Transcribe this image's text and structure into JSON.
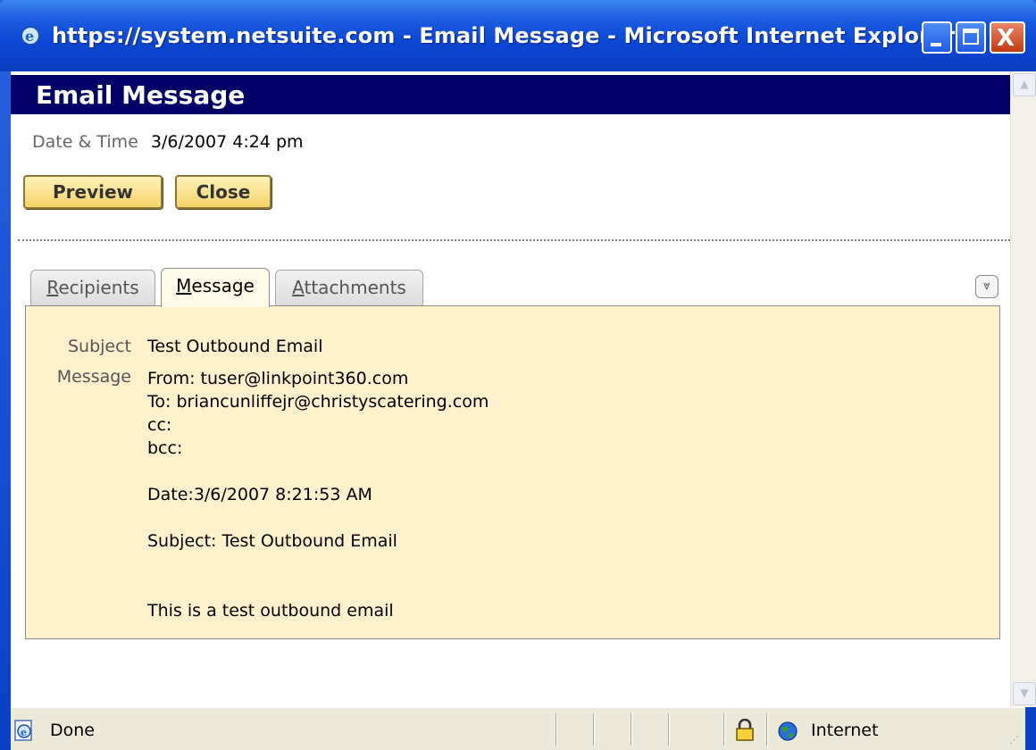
{
  "window": {
    "title": "https://system.netsuite.com - Email Message - Microsoft Internet Explorer",
    "controls": {
      "minimize": "minimize",
      "maximize": "maximize",
      "close": "X"
    }
  },
  "page": {
    "header": "Email Message",
    "date_time_label": "Date & Time",
    "date_time_value": "3/6/2007 4:24 pm",
    "buttons": {
      "preview": "Preview",
      "close": "Close"
    }
  },
  "tabs": [
    {
      "first": "R",
      "rest": "ecipients",
      "active": false
    },
    {
      "first": "M",
      "rest": "essage",
      "active": true
    },
    {
      "first": "A",
      "rest": "ttachments",
      "active": false
    }
  ],
  "message_panel": {
    "subject_label": "Subject",
    "subject_value": "Test Outbound Email",
    "message_label": "Message",
    "message_lines": [
      "From: tuser@linkpoint360.com",
      "To: briancunliffejr@christyscatering.com",
      "cc:",
      "bcc:",
      "",
      "Date:3/6/2007 8:21:53 AM",
      "",
      "Subject: Test Outbound Email",
      "",
      "",
      "This is a test outbound email"
    ]
  },
  "statusbar": {
    "status": "Done",
    "zone": "Internet"
  },
  "icons": {
    "ie": "ie-icon",
    "collapse": "double-chevron-down-icon",
    "lock": "lock-icon",
    "globe": "globe-icon",
    "page_done": "ie-page-icon"
  },
  "colors": {
    "header_bg": "#000066",
    "panel_bg": "#fff1cc",
    "button_bg": "#f5d36a",
    "titlebar": "#0b46d1"
  }
}
